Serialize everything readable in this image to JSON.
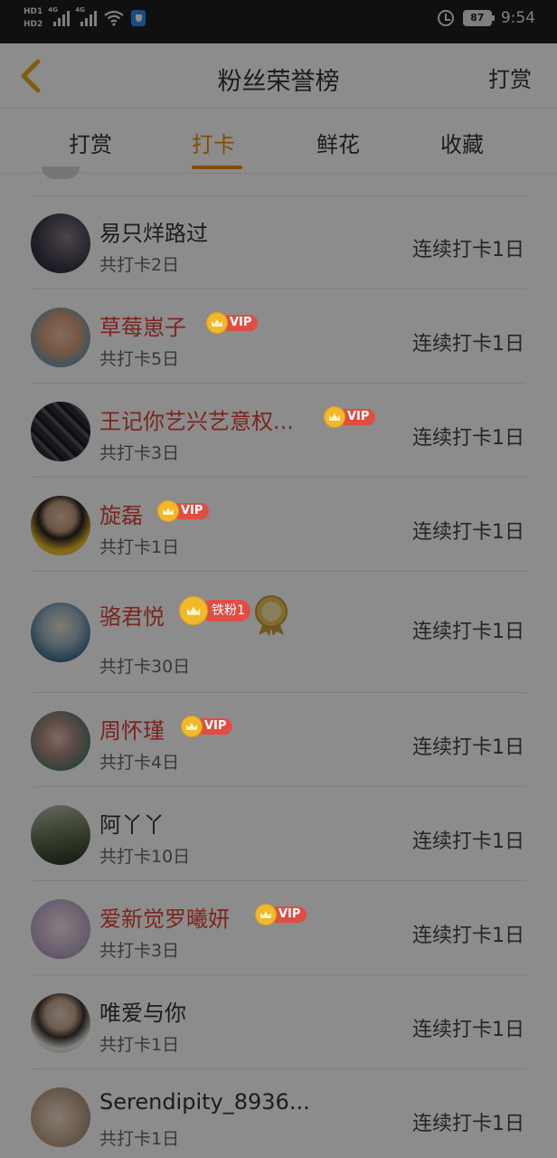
{
  "status_bar": {
    "hd1": "HD1",
    "hd2": "HD2",
    "net1": "4G",
    "net2": "4G",
    "battery": "87",
    "time": "9:54"
  },
  "header": {
    "title": "粉丝荣誉榜",
    "action": "打赏"
  },
  "tabs": [
    {
      "label": "打赏",
      "active": false
    },
    {
      "label": "打卡",
      "active": true
    },
    {
      "label": "鲜花",
      "active": false
    },
    {
      "label": "收藏",
      "active": false
    }
  ],
  "accent_color": "#f08a12",
  "vip_color": "#e0443a",
  "list": [
    {
      "name": "易只烊路过",
      "total": "共打卡2日",
      "streak": "连续打卡1日",
      "vip": false,
      "badge": "",
      "avatar_color": "#3b3a4a"
    },
    {
      "name": "草莓崽子",
      "total": "共打卡5日",
      "streak": "连续打卡1日",
      "vip": true,
      "badge": "VIP",
      "avatar_color": "#c98f7a"
    },
    {
      "name": "王记你艺兴艺意权...",
      "total": "共打卡3日",
      "streak": "连续打卡1日",
      "vip": true,
      "badge": "VIP",
      "avatar_color": "#2d2a33"
    },
    {
      "name": "旋磊",
      "total": "共打卡1日",
      "streak": "连续打卡1日",
      "vip": true,
      "badge": "VIP",
      "avatar_color": "#e8b92a"
    },
    {
      "name": "骆君悦",
      "total": "共打卡30日",
      "streak": "连续打卡1日",
      "vip": true,
      "badge": "铁粉1",
      "medal": "lv2",
      "avatar_color": "#3e6c8a"
    },
    {
      "name": "周怀瑾",
      "total": "共打卡4日",
      "streak": "连续打卡1日",
      "vip": true,
      "badge": "VIP",
      "avatar_color": "#5a7a6b"
    },
    {
      "name": "阿丫丫",
      "total": "共打卡10日",
      "streak": "连续打卡1日",
      "vip": false,
      "badge": "",
      "avatar_color": "#6f7a5a"
    },
    {
      "name": "爱新觉罗曦妍",
      "total": "共打卡3日",
      "streak": "连续打卡1日",
      "vip": true,
      "badge": "VIP",
      "avatar_color": "#b9a9c9"
    },
    {
      "name": "唯爱与你",
      "total": "共打卡1日",
      "streak": "连续打卡1日",
      "vip": false,
      "badge": "",
      "avatar_color": "#c8c2b6"
    },
    {
      "name": "Serendipity_8936...",
      "total": "共打卡1日",
      "streak": "连续打卡1日",
      "vip": false,
      "badge": "",
      "avatar_color": "#b89c86"
    }
  ]
}
